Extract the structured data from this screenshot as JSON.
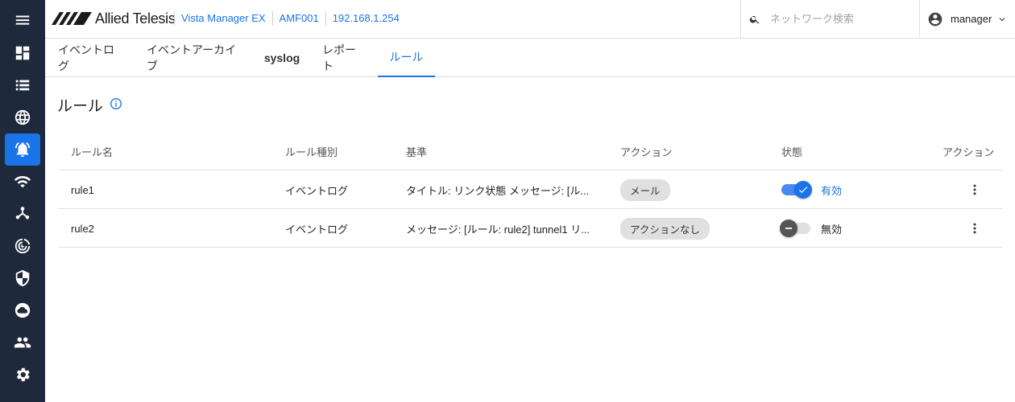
{
  "sidebar": {
    "items": [
      {
        "icon": "menu-icon"
      },
      {
        "icon": "dashboard-icon"
      },
      {
        "icon": "list-icon"
      },
      {
        "icon": "globe-icon"
      },
      {
        "icon": "alarm-icon",
        "active": true
      },
      {
        "icon": "wifi-icon"
      },
      {
        "icon": "topology-icon"
      },
      {
        "icon": "radar-icon"
      },
      {
        "icon": "shield-icon"
      },
      {
        "icon": "cloud-icon"
      },
      {
        "icon": "users-icon"
      },
      {
        "icon": "gear-icon"
      }
    ]
  },
  "header": {
    "brand": "Allied Telesis",
    "crumbs": [
      "Vista Manager EX",
      "AMF001",
      "192.168.1.254"
    ],
    "search_placeholder": "ネットワーク検索",
    "user": "manager"
  },
  "tabs": [
    {
      "label": "イベントログ"
    },
    {
      "label": "イベントアーカイブ"
    },
    {
      "label": "syslog",
      "bold": true
    },
    {
      "label": "レポート"
    },
    {
      "label": "ルール",
      "active": true
    }
  ],
  "page": {
    "title": "ルール"
  },
  "table": {
    "headers": [
      "ルール名",
      "ルール種別",
      "基準",
      "アクション",
      "状態",
      "アクション"
    ],
    "rows": [
      {
        "name": "rule1",
        "type": "イベントログ",
        "criteria": "タイトル: リンク状態 メッセージ: [ル...",
        "action": "メール",
        "state": "有効",
        "enabled": true
      },
      {
        "name": "rule2",
        "type": "イベントログ",
        "criteria": "メッセージ: [ルール: rule2] tunnel1 リ...",
        "action": "アクションなし",
        "state": "無効",
        "enabled": false
      }
    ]
  },
  "colors": {
    "accent": "#1a73e8",
    "sidebar": "#1e2a3c"
  }
}
